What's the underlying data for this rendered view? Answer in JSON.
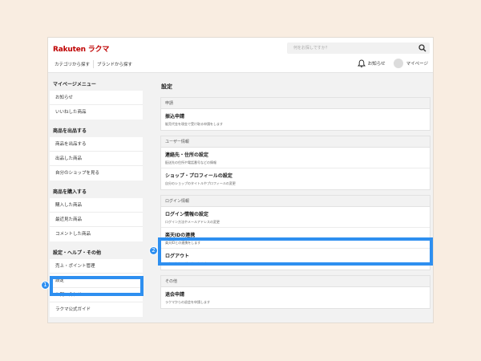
{
  "header": {
    "logo_main": "Rakuten",
    "logo_sub": "ラクマ",
    "search_placeholder": "何をお探しですか？",
    "nav": [
      "カテゴリから探す",
      "ブランドから探す"
    ],
    "notifications": "お知らせ",
    "mypage": "マイページ"
  },
  "sidebar": {
    "sections": [
      {
        "title": "マイページメニュー",
        "items": [
          "お知らせ",
          "いいねした商品"
        ]
      },
      {
        "title": "商品を出品する",
        "items": [
          "商品を出品する",
          "出品した商品",
          "自分のショップを見る"
        ]
      },
      {
        "title": "商品を購入する",
        "items": [
          "購入した商品",
          "最近見た商品",
          "コメントした商品"
        ]
      },
      {
        "title": "設定・ヘルプ・その他",
        "items": [
          "売上・ポイント管理",
          "設定",
          "お問い合わせ",
          "ラクマ公式ガイド"
        ]
      }
    ]
  },
  "main": {
    "title": "設定",
    "cards": [
      {
        "title": "申請",
        "items": [
          {
            "title": "振込申請",
            "sub": "販売代金を現金で受け取る申請をします"
          }
        ]
      },
      {
        "title": "ユーザー情報",
        "items": [
          {
            "title": "連絡先・住所の設定",
            "sub": "配送先の住所や電話番号などの情報"
          },
          {
            "title": "ショップ・プロフィールの設定",
            "sub": "自分のショップのタイトルやプロフィールの変更"
          }
        ]
      },
      {
        "title": "ログイン情報",
        "items": [
          {
            "title": "ログイン情報の設定",
            "sub": "ログイン方法やメールアドレスの変更"
          },
          {
            "title": "楽天IDの連携",
            "sub": "楽天IDとの連携をします"
          },
          {
            "title": "ログアウト",
            "sub": "ラクマからログアウトします"
          }
        ]
      },
      {
        "title": "その他",
        "items": [
          {
            "title": "退会申請",
            "sub": "ラクマからの退会を申請します"
          }
        ]
      }
    ]
  },
  "annotations": {
    "marker_1": "1",
    "marker_2": "2",
    "highlight_color": "#2e8ff0"
  },
  "colors": {
    "brand": "#bf0000",
    "background": "#f9ede1"
  }
}
